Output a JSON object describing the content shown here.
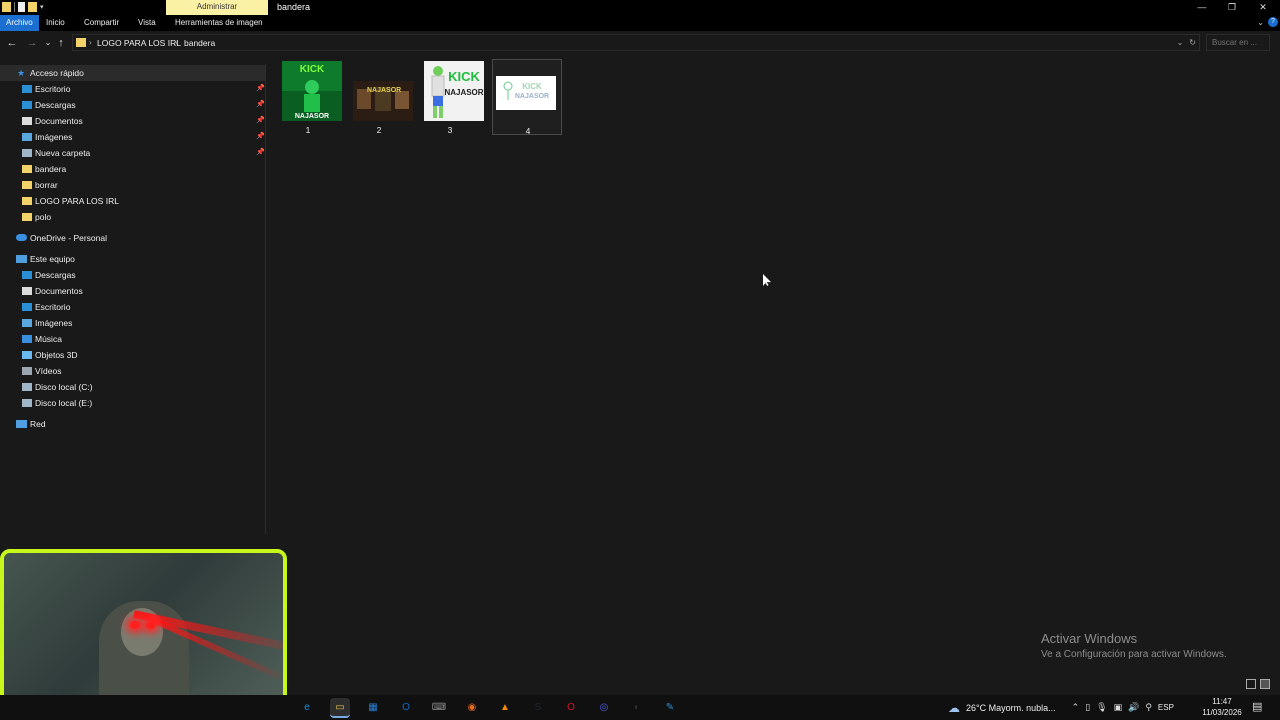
{
  "window": {
    "title": "bandera",
    "context_tab": "Administrar",
    "controls": {
      "minimize": "—",
      "restore": "❐",
      "close": "✕"
    }
  },
  "ribbon": {
    "tabs": [
      {
        "label": "Archivo",
        "active": true
      },
      {
        "label": "Inicio"
      },
      {
        "label": "Compartir"
      },
      {
        "label": "Vista"
      },
      {
        "label": "Herramientas de imagen"
      }
    ],
    "expand_icon": "chevron-down-icon",
    "help_icon": "?"
  },
  "address": {
    "crumbs": [
      "LOGO PARA LOS IRL",
      "bandera"
    ],
    "search_placeholder": "Buscar en ..."
  },
  "sidebar": {
    "quick_access": {
      "label": "Acceso rápido",
      "items": [
        {
          "label": "Escritorio",
          "icon": "desktop-icon",
          "pinned": true,
          "color": "#2b8fd8"
        },
        {
          "label": "Descargas",
          "icon": "download-icon",
          "pinned": true,
          "color": "#2b8fd8"
        },
        {
          "label": "Documentos",
          "icon": "documents-icon",
          "pinned": true,
          "color": "#dcdcdc"
        },
        {
          "label": "Imágenes",
          "icon": "pictures-icon",
          "pinned": true,
          "color": "#5aa7e0"
        },
        {
          "label": "Nueva carpeta",
          "icon": "network-folder-icon",
          "pinned": true,
          "color": "#9fb7c9"
        },
        {
          "label": "bandera",
          "icon": "folder-icon",
          "pinned": false,
          "color": "#f3d26a"
        },
        {
          "label": "borrar",
          "icon": "folder-icon",
          "pinned": false,
          "color": "#f3d26a"
        },
        {
          "label": "LOGO PARA LOS IRL",
          "icon": "folder-icon",
          "pinned": false,
          "color": "#f3d26a"
        },
        {
          "label": "polo",
          "icon": "folder-icon",
          "pinned": false,
          "color": "#f3d26a"
        }
      ]
    },
    "onedrive": {
      "label": "OneDrive - Personal"
    },
    "this_pc": {
      "label": "Este equipo",
      "items": [
        {
          "label": "Descargas",
          "icon": "download-icon",
          "color": "#2b8fd8"
        },
        {
          "label": "Documentos",
          "icon": "documents-icon",
          "color": "#dcdcdc"
        },
        {
          "label": "Escritorio",
          "icon": "desktop-icon",
          "color": "#2b8fd8"
        },
        {
          "label": "Imágenes",
          "icon": "pictures-icon",
          "color": "#5aa7e0"
        },
        {
          "label": "Música",
          "icon": "music-icon",
          "color": "#3a8fe0"
        },
        {
          "label": "Objetos 3D",
          "icon": "3d-objects-icon",
          "color": "#6ab8f0"
        },
        {
          "label": "Vídeos",
          "icon": "videos-icon",
          "color": "#9aa7b2"
        },
        {
          "label": "Disco local (C:)",
          "icon": "drive-icon",
          "color": "#9fb7c9"
        },
        {
          "label": "Disco local (E:)",
          "icon": "drive-icon",
          "color": "#9fb7c9"
        }
      ]
    },
    "network": {
      "label": "Red"
    }
  },
  "files": [
    {
      "name": "1",
      "thumb": "kick-green-character"
    },
    {
      "name": "2",
      "thumb": "najasor-dark-banner"
    },
    {
      "name": "3",
      "thumb": "kick-najasor-character"
    },
    {
      "name": "4",
      "thumb": "kick-najasor-white",
      "selected": true
    }
  ],
  "thumb_texts": {
    "t1_top": "KICK",
    "t1_bottom": "NAJASOR",
    "t2": "NAJASOR",
    "t3_top": "KICK",
    "t3_bottom": "NAJASOR",
    "t4_top": "KICK",
    "t4_bottom": "NAJASOR"
  },
  "watermark": {
    "title": "Activar Windows",
    "subtitle": "Ve a Configuración para activar Windows."
  },
  "taskbar": {
    "weather": "26°C  Mayorm. nubla...",
    "language": "ESP",
    "time": "11:47",
    "date": "11/03/2026",
    "apps": [
      {
        "name": "edge-icon",
        "glyph": "e",
        "color": "#1f8fd6"
      },
      {
        "name": "file-explorer-icon",
        "glyph": "▭",
        "color": "#e8c24a",
        "active": true
      },
      {
        "name": "store-icon",
        "glyph": "▦",
        "color": "#2a7fd4"
      },
      {
        "name": "outlook-icon",
        "glyph": "O",
        "color": "#1565c0"
      },
      {
        "name": "keyboard-icon",
        "glyph": "⌨",
        "color": "#8c8c8c"
      },
      {
        "name": "firefox-icon",
        "glyph": "◉",
        "color": "#e66a1f"
      },
      {
        "name": "vlc-icon",
        "glyph": "▲",
        "color": "#f08a00"
      },
      {
        "name": "steam-icon",
        "glyph": "S",
        "color": "#1b2838"
      },
      {
        "name": "opera-icon",
        "glyph": "O",
        "color": "#d1162a"
      },
      {
        "name": "discord-icon",
        "glyph": "◎",
        "color": "#5865f2"
      },
      {
        "name": "obs-icon",
        "glyph": "◐",
        "color": "#302e31"
      },
      {
        "name": "paint-icon",
        "glyph": "✎",
        "color": "#2f8ed6"
      }
    ]
  }
}
